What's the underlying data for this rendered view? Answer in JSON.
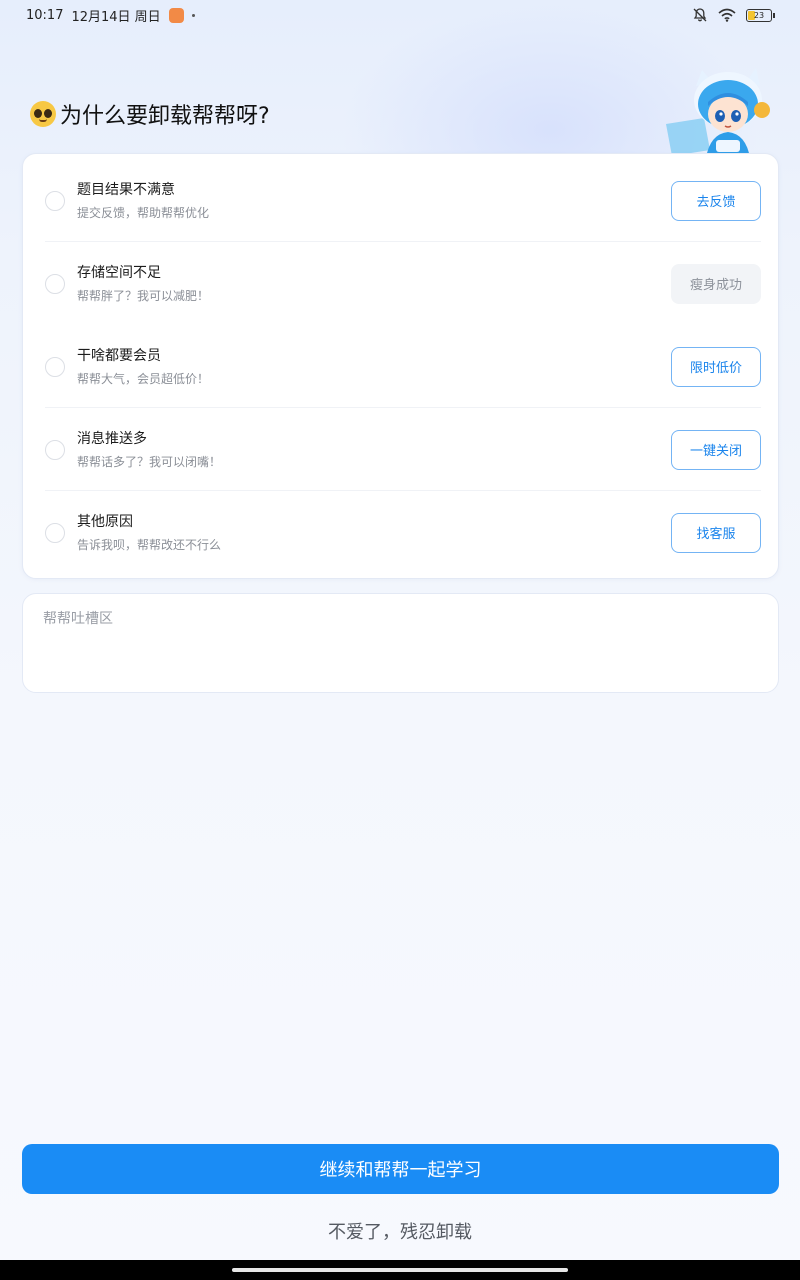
{
  "status_bar": {
    "time": "10:17",
    "date": "12月14日 周日",
    "battery_level": "23",
    "battery_color": "#f3c431"
  },
  "page": {
    "title": "为什么要卸载帮帮呀?",
    "title_emoji": "pleading-face-emoji"
  },
  "reasons": [
    {
      "title": "题目结果不满意",
      "subtitle": "提交反馈，帮助帮帮优化",
      "action": "去反馈",
      "action_enabled": true
    },
    {
      "title": "存储空间不足",
      "subtitle": "帮帮胖了？我可以减肥！",
      "action": "瘦身成功",
      "action_enabled": false
    },
    {
      "title": "干啥都要会员",
      "subtitle": "帮帮大气，会员超低价！",
      "action": "限时低价",
      "action_enabled": true
    },
    {
      "title": "消息推送多",
      "subtitle": "帮帮话多了？我可以闭嘴！",
      "action": "一键关闭",
      "action_enabled": true
    },
    {
      "title": "其他原因",
      "subtitle": "告诉我呗，帮帮改还不行么",
      "action": "找客服",
      "action_enabled": true
    }
  ],
  "feedback": {
    "placeholder": "帮帮吐槽区"
  },
  "buttons": {
    "continue_label": "继续和帮帮一起学习",
    "uninstall_label": "不爱了，残忍卸载"
  },
  "colors": {
    "primary": "#1a8cf5",
    "action_text": "#1a84ec",
    "action_border": "#74b4f4"
  }
}
